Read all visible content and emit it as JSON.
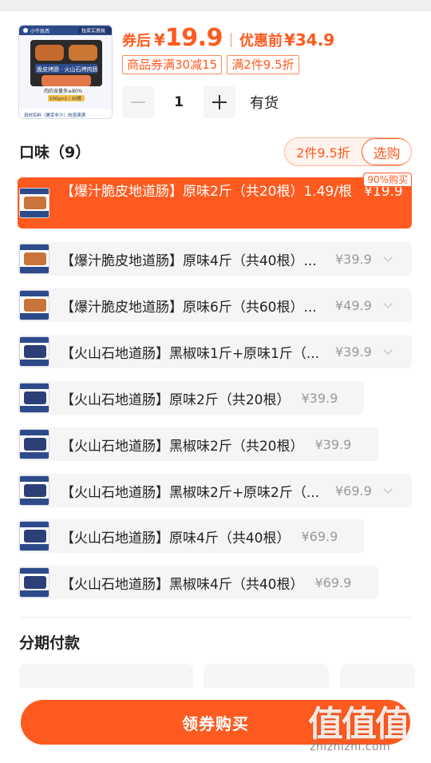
{
  "product": {
    "thumbnail": {
      "brand": "小牛凯西",
      "ribbon": "独家实惠装",
      "headline": "脆皮烤肠 · 火山石烤肉肠",
      "subline": "肉的含量多≥80%",
      "spec": "100g×2 / 20根",
      "footer": "真材实料（屠宰非汁）肉感满满"
    },
    "price_label": "券后",
    "currency": "¥",
    "price": "19.9",
    "original_price_label": "优惠前",
    "original_price": "¥34.9",
    "tags": [
      "商品券满30减15",
      "满2件9.5折"
    ],
    "quantity": "1",
    "stock_status": "有货"
  },
  "flavor": {
    "title": "口味（9）",
    "promo_text": "2件9.5折",
    "promo_button": "选购",
    "options": [
      {
        "name": "【爆汁脆皮地道肠】原味2斤（共20根）1.49/根",
        "price": "¥19.9",
        "badge": "90%购买",
        "selected": true,
        "expandable": false,
        "image_style": "grill"
      },
      {
        "name": "【爆汁脆皮地道肠】原味4斤（共40根）...",
        "price": "¥39.9",
        "selected": false,
        "expandable": true,
        "image_style": "grill"
      },
      {
        "name": "【爆汁脆皮地道肠】原味6斤（共60根）...",
        "price": "¥49.9",
        "selected": false,
        "expandable": true,
        "image_style": "grill"
      },
      {
        "name": "【火山石地道肠】黑椒味1斤+原味1斤（...",
        "price": "¥39.9",
        "selected": false,
        "expandable": true,
        "image_style": "pack"
      },
      {
        "name": "【火山石地道肠】原味2斤（共20根）",
        "price": "¥39.9",
        "selected": false,
        "expandable": false,
        "image_style": "pack"
      },
      {
        "name": "【火山石地道肠】黑椒味2斤（共20根）",
        "price": "¥39.9",
        "selected": false,
        "expandable": false,
        "image_style": "pack"
      },
      {
        "name": "【火山石地道肠】黑椒味2斤+原味2斤（...",
        "price": "¥69.9",
        "selected": false,
        "expandable": true,
        "image_style": "pack"
      },
      {
        "name": "【火山石地道肠】原味4斤（共40根）",
        "price": "¥69.9",
        "selected": false,
        "expandable": false,
        "image_style": "pack"
      },
      {
        "name": "【火山石地道肠】黑椒味4斤（共40根）",
        "price": "¥69.9",
        "selected": false,
        "expandable": false,
        "image_style": "pack"
      }
    ]
  },
  "installment": {
    "title": "分期付款"
  },
  "action": {
    "buy_label": "领券购买"
  },
  "watermark": {
    "logo": "值值值",
    "domain": "zhizhizhi.com"
  },
  "colors": {
    "accent": "#ff5a1f",
    "row_bg": "#f5f5f5",
    "muted": "#999999"
  }
}
